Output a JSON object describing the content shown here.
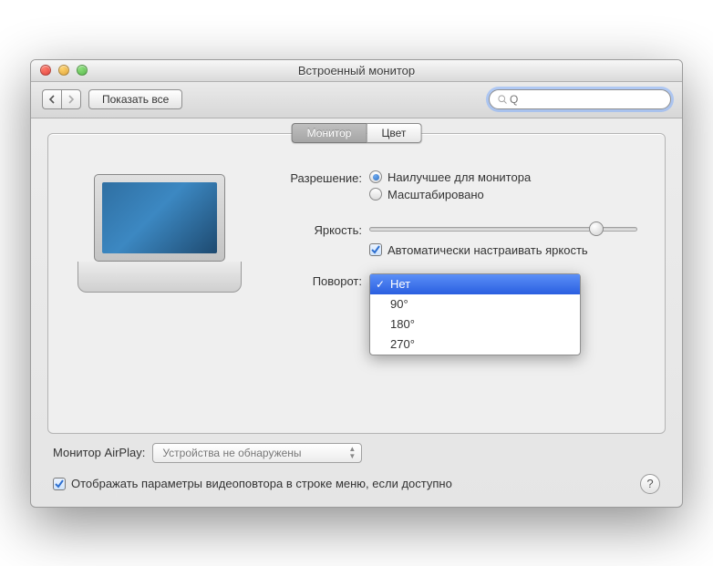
{
  "window": {
    "title": "Встроенный монитор"
  },
  "toolbar": {
    "show_all": "Показать все"
  },
  "search": {
    "placeholder": "Q"
  },
  "tabs": {
    "monitor": "Монитор",
    "color": "Цвет"
  },
  "labels": {
    "resolution": "Разрешение:",
    "brightness": "Яркость:",
    "rotation": "Поворот:",
    "airplay": "Монитор AirPlay:"
  },
  "resolution": {
    "best": "Наилучшее для монитора",
    "scaled": "Масштабировано"
  },
  "brightness": {
    "auto": "Автоматически настраивать яркость"
  },
  "rotation_options": {
    "none": "Нет",
    "r90": "90°",
    "r180": "180°",
    "r270": "270°"
  },
  "airplay": {
    "none": "Устройства не обнаружены"
  },
  "mirror": {
    "label": "Отображать параметры видеоповтора в строке меню, если доступно"
  },
  "help": "?"
}
